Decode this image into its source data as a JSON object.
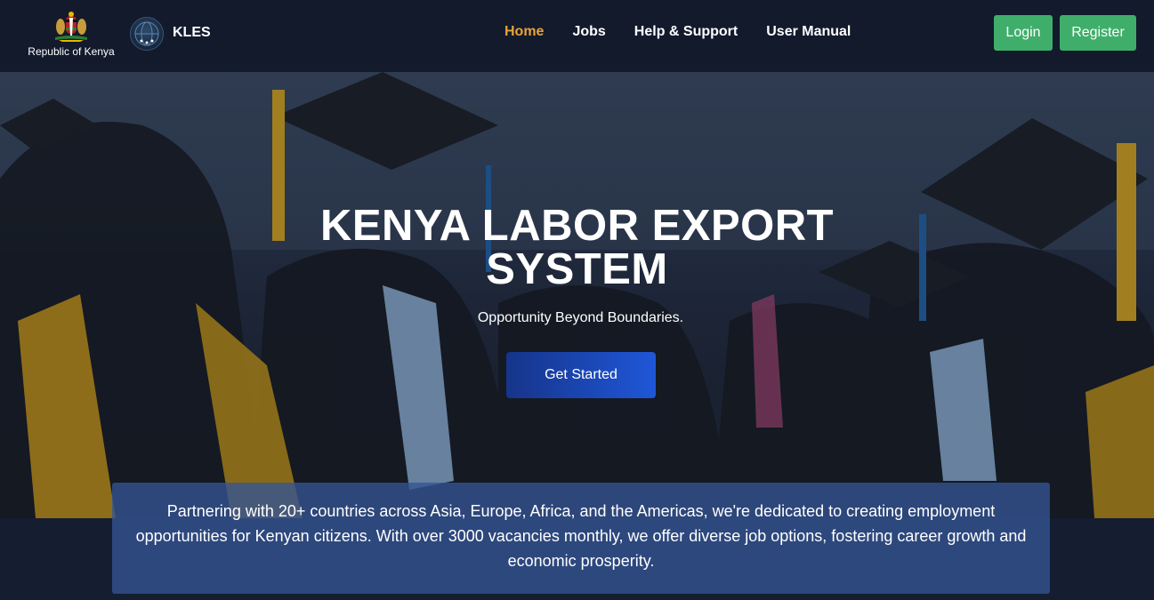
{
  "header": {
    "gov_label": "Republic of Kenya",
    "brand": "KLES",
    "nav": [
      {
        "label": "Home",
        "active": true
      },
      {
        "label": "Jobs",
        "active": false
      },
      {
        "label": "Help & Support",
        "active": false
      },
      {
        "label": "User Manual",
        "active": false
      }
    ],
    "login_label": "Login",
    "register_label": "Register"
  },
  "hero": {
    "title_line1": "KENYA LABOR EXPORT",
    "title_line2": "SYSTEM",
    "subtitle": "Opportunity Beyond Boundaries.",
    "cta_label": "Get Started"
  },
  "info": {
    "text": "Partnering with 20+ countries across Asia, Europe, Africa, and the Americas, we're dedicated to creating employment opportunities for Kenyan citizens. With over 3000 vacancies monthly, we offer diverse job options, fostering career growth and economic prosperity."
  },
  "colors": {
    "header_bg": "#121a2c",
    "nav_active": "#e9a23b",
    "button_green": "#3fae6a",
    "cta_blue": "#1f57d8",
    "info_box": "#345494"
  },
  "icons": {
    "gov_logo": "coat-of-arms-icon",
    "brand_logo": "kles-globe-icon"
  }
}
